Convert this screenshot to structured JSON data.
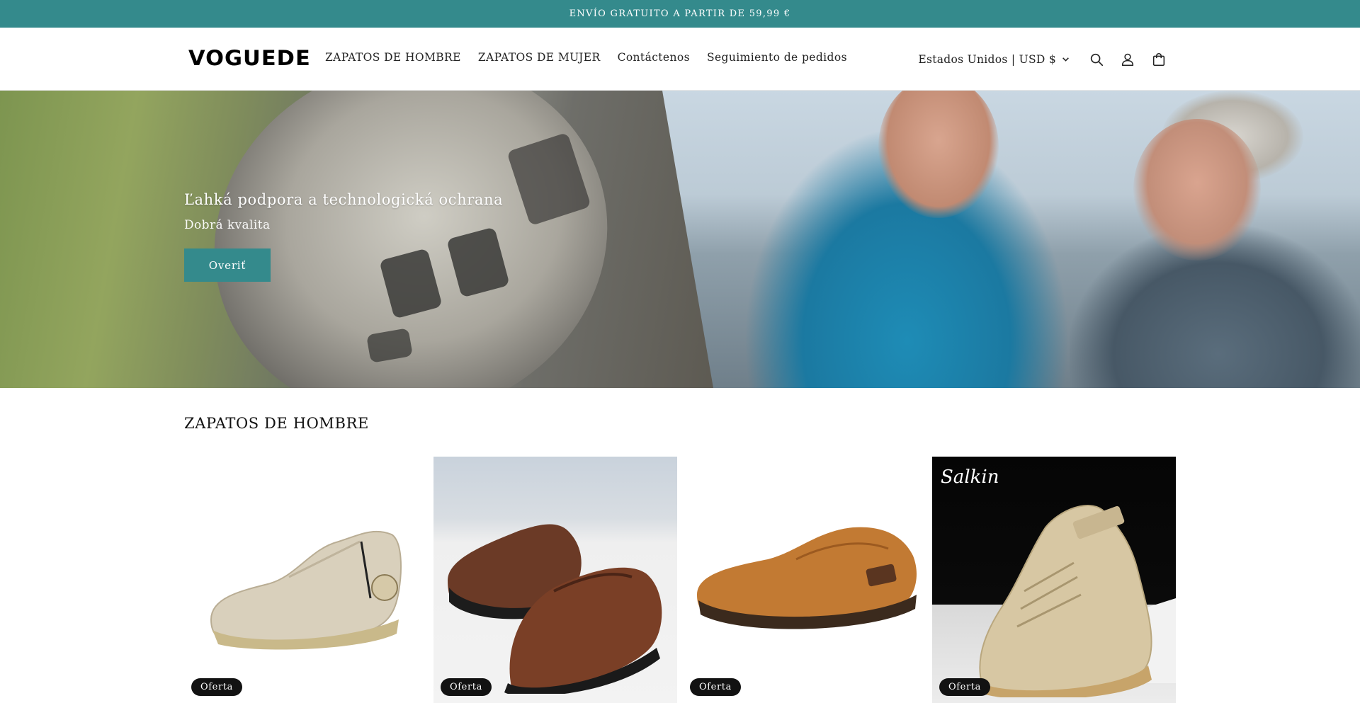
{
  "announcement": {
    "text": "ENVÍO GRATUITO A PARTIR DE 59,99 €"
  },
  "header": {
    "logo": "VOGUEDE",
    "nav": [
      {
        "label": "ZAPATOS DE HOMBRE"
      },
      {
        "label": "ZAPATOS DE MUJER"
      },
      {
        "label": "Contáctenos"
      },
      {
        "label": "Seguimiento de pedidos"
      }
    ],
    "locale": "Estados Unidos | USD $",
    "icons": [
      "search-icon",
      "account-icon",
      "cart-icon"
    ]
  },
  "hero": {
    "title": "Ľahká podpora a technologická ochrana",
    "subtitle": "Dobrá kvalita",
    "button": "Overiť"
  },
  "collection": {
    "title": "ZAPATOS DE HOMBRE",
    "products": [
      {
        "badge": "Oferta"
      },
      {
        "badge": "Oferta"
      },
      {
        "badge": "Oferta"
      },
      {
        "badge": "Oferta",
        "brand_mark": "Salkin"
      }
    ]
  },
  "colors": {
    "accent": "#348a8c",
    "badge_bg": "#121212",
    "text": "#121212"
  }
}
